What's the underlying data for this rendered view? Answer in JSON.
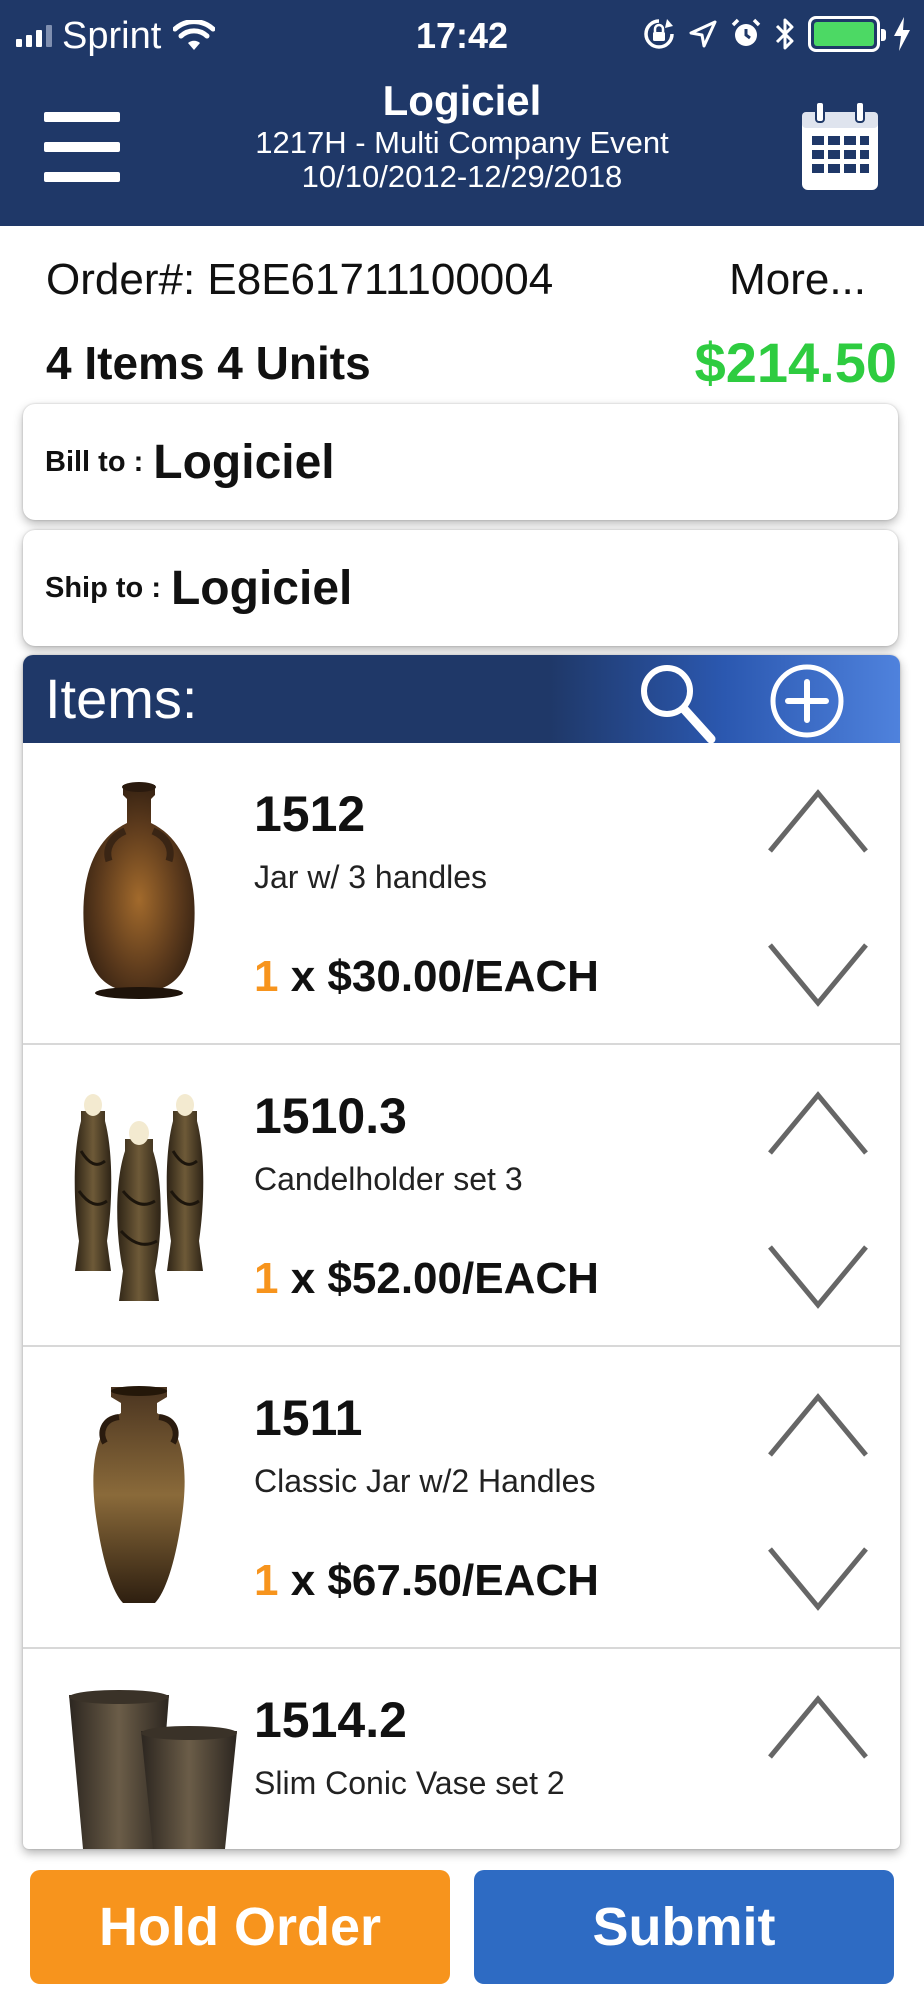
{
  "status_bar": {
    "carrier": "Sprint",
    "time": "17:42"
  },
  "header": {
    "title": "Logiciel",
    "event": "1217H -  Multi Company Event",
    "dates": "10/10/2012-12/29/2018"
  },
  "order": {
    "number_label": "Order#: E8E61711100004",
    "more_label": "More...",
    "counts": "4 Items 4 Units",
    "total": "$214.50"
  },
  "bill_to": {
    "label": "Bill  to :",
    "value": "Logiciel"
  },
  "ship_to": {
    "label": "Ship to :",
    "value": "Logiciel"
  },
  "items_header": {
    "title": "Items:"
  },
  "items": [
    {
      "code": "1512",
      "description": "Jar w/ 3 handles",
      "qty": "1",
      "price": "x $30.00/EACH",
      "image": "jar-three-handles"
    },
    {
      "code": "1510.3",
      "description": "Candelholder set 3",
      "qty": "1",
      "price": "x $52.00/EACH",
      "image": "candleholder-set"
    },
    {
      "code": "1511",
      "description": "Classic Jar w/2 Handles",
      "qty": "1",
      "price": "x $67.50/EACH",
      "image": "classic-jar"
    },
    {
      "code": "1514.2",
      "description": "Slim Conic Vase set 2",
      "qty": "",
      "price": "",
      "image": "conic-vase-set"
    }
  ],
  "buttons": {
    "hold": "Hold Order",
    "submit": "Submit"
  },
  "colors": {
    "header": "#1f3868",
    "total": "#2ecc40",
    "quantity": "#f7941d",
    "hold_button": "#f7941d",
    "submit_button": "#2e6bc3",
    "battery": "#4cd964"
  },
  "icons": [
    "signal-icon",
    "wifi-icon",
    "lock-rotation-icon",
    "location-icon",
    "alarm-icon",
    "bluetooth-icon",
    "battery-icon",
    "charging-icon",
    "menu-icon",
    "calendar-icon",
    "search-icon",
    "add-circle-icon",
    "chevron-up-icon",
    "chevron-down-icon"
  ]
}
